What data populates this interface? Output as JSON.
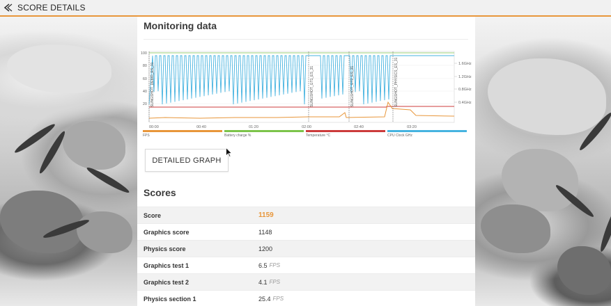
{
  "topbar": {
    "title": "SCORE DETAILS"
  },
  "monitoring": {
    "title": "Monitoring data",
    "detailed_button": "DETAILED GRAPH"
  },
  "chart_data": {
    "type": "line",
    "x_ticks": [
      "00:00",
      "00:40",
      "01:20",
      "02:00",
      "02:40",
      "03:20"
    ],
    "y_left_ticks": [
      "100",
      "80",
      "60",
      "40",
      "20"
    ],
    "y_right_ticks": [
      "1.6GHz",
      "1.2GHz",
      "0.8GHz",
      "0.4GHz"
    ],
    "markers": [
      "SLINGSHOT_DEMO_ES_31",
      "SLINGSHOT_GT1_ES_31",
      "SLINGSHOT_GT2_ES_31",
      "SLINGSHOT_PHYSICS_ES_31"
    ],
    "series": [
      {
        "name": "FPS",
        "color": "#e8963a"
      },
      {
        "name": "Battery charge %",
        "color": "#7cc44a"
      },
      {
        "name": "Temperature °C",
        "color": "#cc3b3b"
      },
      {
        "name": "CPU Clock GHz",
        "color": "#46b3e0"
      }
    ]
  },
  "scores": {
    "title": "Scores",
    "rows": [
      {
        "label": "Score",
        "value": "1159",
        "unit": ""
      },
      {
        "label": "Graphics score",
        "value": "1148",
        "unit": ""
      },
      {
        "label": "Physics score",
        "value": "1200",
        "unit": ""
      },
      {
        "label": "Graphics test 1",
        "value": "6.5",
        "unit": "FPS"
      },
      {
        "label": "Graphics test 2",
        "value": "4.1",
        "unit": "FPS"
      },
      {
        "label": "Physics section 1",
        "value": "25.4",
        "unit": "FPS"
      }
    ]
  }
}
